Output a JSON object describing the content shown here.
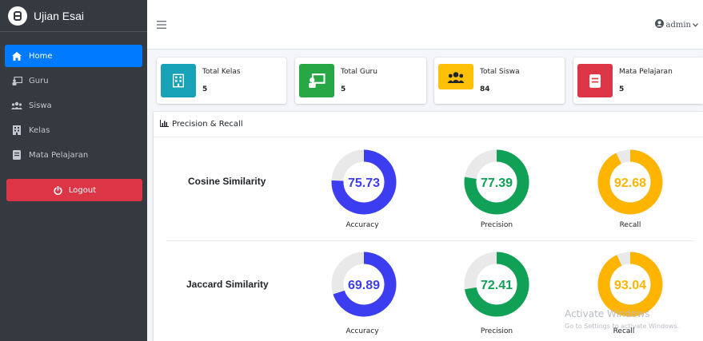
{
  "app": {
    "title": "Ujian Esai"
  },
  "sidebar": {
    "items": [
      {
        "label": "Home",
        "icon": "home-icon"
      },
      {
        "label": "Guru",
        "icon": "chalkboard-teacher-icon"
      },
      {
        "label": "Siswa",
        "icon": "users-icon"
      },
      {
        "label": "Kelas",
        "icon": "building-icon"
      },
      {
        "label": "Mata Pelajaran",
        "icon": "book-icon"
      }
    ],
    "logout_label": "Logout"
  },
  "topbar": {
    "user_label": "admin"
  },
  "stats": [
    {
      "label": "Total Kelas",
      "value": "5",
      "color": "#17a2b8",
      "icon": "building-icon"
    },
    {
      "label": "Total Guru",
      "value": "5",
      "color": "#28a745",
      "icon": "chalkboard-teacher-icon"
    },
    {
      "label": "Total Siswa",
      "value": "84",
      "color": "#ffc107",
      "icon": "users-icon"
    },
    {
      "label": "Mata Pelajaran",
      "value": "5",
      "color": "#dc3545",
      "icon": "book-icon"
    }
  ],
  "card": {
    "title": "Precision & Recall"
  },
  "results": [
    {
      "method": "Cosine Similarity",
      "metrics": [
        {
          "label": "Accuracy",
          "value": 75.73,
          "display": "75.73",
          "color": "#3c3cf0"
        },
        {
          "label": "Precision",
          "value": 77.39,
          "display": "77.39",
          "color": "#10a157"
        },
        {
          "label": "Recall",
          "value": 92.68,
          "display": "92.68",
          "color": "#ffb400"
        }
      ]
    },
    {
      "method": "Jaccard Similarity",
      "metrics": [
        {
          "label": "Accuracy",
          "value": 69.89,
          "display": "69.89",
          "color": "#3c3cf0"
        },
        {
          "label": "Precision",
          "value": 72.41,
          "display": "72.41",
          "color": "#10a157"
        },
        {
          "label": "Recall",
          "value": 93.04,
          "display": "93.04",
          "color": "#ffb400"
        }
      ]
    }
  ],
  "watermark": {
    "line1": "Activate Windows",
    "line2": "Go to Settings to activate Windows."
  }
}
